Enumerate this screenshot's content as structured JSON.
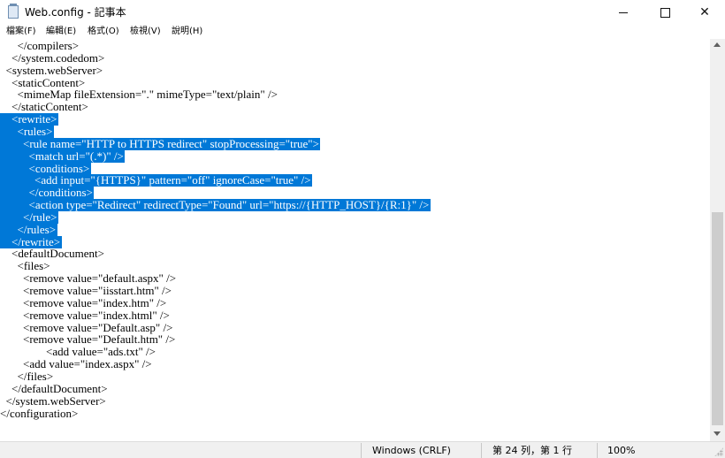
{
  "window": {
    "title": "Web.config - 記事本",
    "icon": "notepad-icon",
    "controls": {
      "minimize": "minimize-icon",
      "maximize": "maximize-icon",
      "close": "✕"
    }
  },
  "menu": [
    {
      "label": "檔案(F)"
    },
    {
      "label": "編輯(E)"
    },
    {
      "label": "格式(O)"
    },
    {
      "label": "檢視(V)"
    },
    {
      "label": "說明(H)"
    }
  ],
  "editor": {
    "selection_color": "#0078d7",
    "lines": [
      {
        "text": "      </compilers>",
        "selected": false
      },
      {
        "text": "    </system.codedom>",
        "selected": false
      },
      {
        "text": "  <system.webServer>",
        "selected": false
      },
      {
        "text": "    <staticContent>",
        "selected": false
      },
      {
        "text": "      <mimeMap fileExtension=\".\" mimeType=\"text/plain\" />",
        "selected": false
      },
      {
        "text": "    </staticContent>",
        "selected": false
      },
      {
        "text": "    <rewrite>",
        "selected": true
      },
      {
        "text": "      <rules>",
        "selected": true
      },
      {
        "text": "        <rule name=\"HTTP to HTTPS redirect\" stopProcessing=\"true\">",
        "selected": true
      },
      {
        "text": "          <match url=\"(.*)\" />",
        "selected": true
      },
      {
        "text": "          <conditions>",
        "selected": true
      },
      {
        "text": "            <add input=\"{HTTPS}\" pattern=\"off\" ignoreCase=\"true\" />",
        "selected": true
      },
      {
        "text": "          </conditions>",
        "selected": true
      },
      {
        "text": "          <action type=\"Redirect\" redirectType=\"Found\" url=\"https://{HTTP_HOST}/{R:1}\" />",
        "selected": true
      },
      {
        "text": "        </rule>",
        "selected": true
      },
      {
        "text": "      </rules>",
        "selected": true
      },
      {
        "text": "    </rewrite>",
        "selected": true
      },
      {
        "text": "    <defaultDocument>",
        "selected": false
      },
      {
        "text": "      <files>",
        "selected": false
      },
      {
        "text": "        <remove value=\"default.aspx\" />",
        "selected": false
      },
      {
        "text": "        <remove value=\"iisstart.htm\" />",
        "selected": false
      },
      {
        "text": "        <remove value=\"index.htm\" />",
        "selected": false
      },
      {
        "text": "        <remove value=\"index.html\" />",
        "selected": false
      },
      {
        "text": "        <remove value=\"Default.asp\" />",
        "selected": false
      },
      {
        "text": "        <remove value=\"Default.htm\" />",
        "selected": false
      },
      {
        "text": "                <add value=\"ads.txt\" />",
        "selected": false
      },
      {
        "text": "        <add value=\"index.aspx\" />",
        "selected": false
      },
      {
        "text": "      </files>",
        "selected": false
      },
      {
        "text": "    </defaultDocument>",
        "selected": false
      },
      {
        "text": "  </system.webServer>",
        "selected": false
      },
      {
        "text": "</configuration>",
        "selected": false
      }
    ]
  },
  "status": {
    "encoding": "Windows (CRLF)",
    "position": "第 24 列，第 1 行",
    "zoom": "100%"
  }
}
